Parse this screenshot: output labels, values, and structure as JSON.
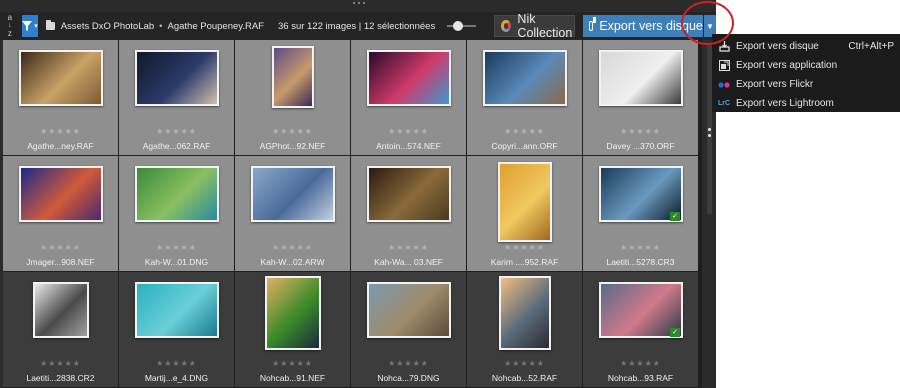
{
  "toolbar": {
    "sort_top": "a",
    "sort_bottom": "z",
    "breadcrumb_folder": "Assets DxO PhotoLab",
    "breadcrumb_file": "Agathe Poupeney.RAF",
    "counts": "36 sur 122 images | 12 sélectionnées",
    "nik_label": "Nik Collection",
    "export_label": "Export vers disque",
    "zoom_slider_fraction": 0.2
  },
  "menu": [
    {
      "icon": "export-disk-icon",
      "label": "Export vers disque",
      "shortcut": "Ctrl+Alt+P"
    },
    {
      "icon": "application-icon",
      "label": "Export vers application",
      "shortcut": ""
    },
    {
      "icon": "flickr-icon",
      "label": "Export vers Flickr",
      "shortcut": ""
    },
    {
      "icon": "lightroom-icon",
      "label": "Export vers Lightroom",
      "shortcut": "",
      "icon_text": "LrC"
    }
  ],
  "grid": [
    {
      "name": "Agathe...ney.RAF",
      "stars": "★★★★★",
      "selected": true,
      "w": 84,
      "h": 56,
      "colors": [
        "#3d2a1a",
        "#c9a265",
        "#7a5a34"
      ],
      "checked": false
    },
    {
      "name": "Agathe...062.RAF",
      "stars": "★★★★★",
      "selected": true,
      "w": 84,
      "h": 56,
      "colors": [
        "#101828",
        "#2a3a6a",
        "#d0c0b0"
      ],
      "checked": false
    },
    {
      "name": "AGPhot...92.NEF",
      "stars": "★★★★★",
      "selected": true,
      "w": 42,
      "h": 62,
      "colors": [
        "#5a4a8a",
        "#c89a6a",
        "#3a2a5a"
      ],
      "checked": false
    },
    {
      "name": "Antoin...574.NEF",
      "stars": "★★★★★",
      "selected": true,
      "w": 84,
      "h": 56,
      "colors": [
        "#2a0a2a",
        "#d03a6a",
        "#3a9ad0"
      ],
      "checked": false
    },
    {
      "name": "Copyri...ann.ORF",
      "stars": "★★★★★",
      "selected": true,
      "w": 84,
      "h": 56,
      "colors": [
        "#1a3a5a",
        "#5a8aba",
        "#8a6a4a"
      ],
      "checked": false
    },
    {
      "name": "Davey ...370.ORF",
      "stars": "★★★★★",
      "selected": true,
      "w": 84,
      "h": 56,
      "colors": [
        "#d8d8d8",
        "#f0f0f0",
        "#3a3a3a"
      ],
      "checked": false
    },
    {
      "name": "Jmager...908.NEF",
      "stars": "★★★★★",
      "selected": true,
      "w": 84,
      "h": 56,
      "colors": [
        "#1a2a8a",
        "#d05a3a",
        "#4a2a6a"
      ],
      "checked": false
    },
    {
      "name": "Kah-W...01.DNG",
      "stars": "★★★★★",
      "selected": true,
      "w": 84,
      "h": 56,
      "colors": [
        "#3a8a3a",
        "#8ac060",
        "#2a8aa0"
      ],
      "checked": false
    },
    {
      "name": "Kah-W...02.ARW",
      "stars": "★★★★★",
      "selected": true,
      "w": 84,
      "h": 56,
      "colors": [
        "#8aa8c8",
        "#4a6a9a",
        "#c0d0e0"
      ],
      "checked": false
    },
    {
      "name": "Kah-Wa... 03.NEF",
      "stars": "★★★★★",
      "selected": true,
      "w": 84,
      "h": 56,
      "colors": [
        "#2a1a10",
        "#8a6a3a",
        "#4a3a20"
      ],
      "checked": false
    },
    {
      "name": "Karim ....952.RAF",
      "stars": "★★★★★",
      "selected": true,
      "w": 54,
      "h": 80,
      "colors": [
        "#e0a030",
        "#f0c860",
        "#a06820"
      ],
      "checked": false
    },
    {
      "name": "Laetiti...5278.CR3",
      "stars": "★★★★★",
      "selected": true,
      "w": 84,
      "h": 56,
      "colors": [
        "#1a3a5a",
        "#6a9ac0",
        "#0a1a2a"
      ],
      "checked": true
    },
    {
      "name": "Laetiti...2838.CR2",
      "stars": "★★★★★",
      "selected": false,
      "w": 56,
      "h": 56,
      "colors": [
        "#e8e8e8",
        "#4a4a4a",
        "#a0a0a0"
      ],
      "checked": false
    },
    {
      "name": "Martij...e_4.DNG",
      "stars": "★★★★★",
      "selected": false,
      "w": 84,
      "h": 56,
      "colors": [
        "#2ab0c0",
        "#6ad0d8",
        "#1a7a90"
      ],
      "checked": false
    },
    {
      "name": "Nohcab...91.NEF",
      "stars": "★★★★★",
      "selected": false,
      "w": 56,
      "h": 74,
      "colors": [
        "#e0b060",
        "#3a8a2a",
        "#1a2a3a"
      ],
      "checked": false
    },
    {
      "name": "Nohca...79.DNG",
      "stars": "★★★★★",
      "selected": false,
      "w": 84,
      "h": 56,
      "colors": [
        "#7a9ab0",
        "#a08a6a",
        "#5a4a3a"
      ],
      "checked": false
    },
    {
      "name": "Nohcab...52.RAF",
      "stars": "★★★★★",
      "selected": false,
      "w": 52,
      "h": 74,
      "colors": [
        "#f0c080",
        "#5a6a7a",
        "#2a2a30"
      ],
      "checked": false
    },
    {
      "name": "Nohcab...93.RAF",
      "stars": "★★★★★",
      "selected": false,
      "w": 84,
      "h": 56,
      "colors": [
        "#5a6a8a",
        "#d07a8a",
        "#2a3a4a"
      ],
      "checked": true
    }
  ]
}
